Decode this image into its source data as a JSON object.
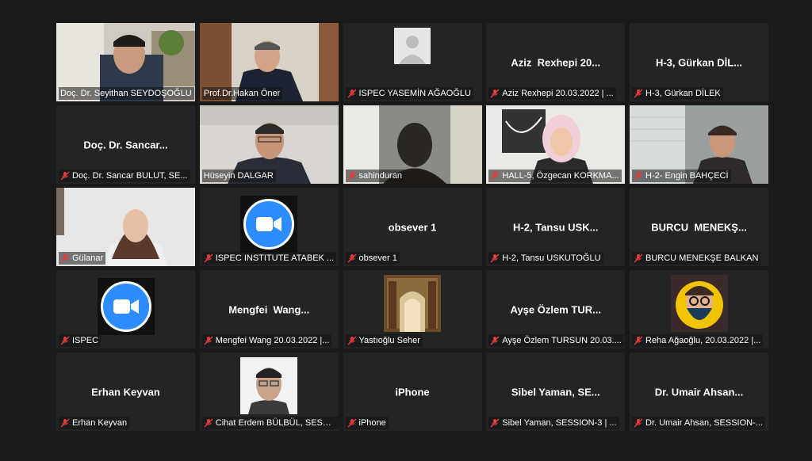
{
  "meeting": {
    "participants": [
      {
        "name": "Doç. Dr. Seyithan SEYDOŞOĞLU",
        "display": ""
      },
      {
        "name": "Prof.Dr.Hakan Öner",
        "display": ""
      },
      {
        "name": "ISPEC YASEMİN AĞAOĞLU",
        "display": ""
      },
      {
        "name": "Aziz  Rexhepi 20.03.2022 | ...",
        "display": "Aziz  Rexhepi 20..."
      },
      {
        "name": "H-3, Gürkan DİLEK",
        "display": "H-3, Gürkan DİL..."
      },
      {
        "name": "Doç. Dr. Sancar BULUT, SE...",
        "display": "Doç. Dr. Sancar..."
      },
      {
        "name": "Hüseyin DALGAR",
        "display": ""
      },
      {
        "name": "sahinduran",
        "display": ""
      },
      {
        "name": "HALL-5, Özgecan KORKMA...",
        "display": ""
      },
      {
        "name": "H-2- Engin BAHÇECİ",
        "display": ""
      },
      {
        "name": "Gülanar",
        "display": ""
      },
      {
        "name": "ISPEC INSTITUTE ATABEK ...",
        "display": ""
      },
      {
        "name": "obsever 1",
        "display": "obsever 1"
      },
      {
        "name": "H-2, Tansu USKUTOĞLU",
        "display": "H-2, Tansu USK..."
      },
      {
        "name": "BURCU MENEKŞE BALKAN",
        "display": "BURCU  MENEKŞ..."
      },
      {
        "name": "ISPEC",
        "display": ""
      },
      {
        "name": "Mengfei Wang 20.03.2022 |...",
        "display": "Mengfei  Wang..."
      },
      {
        "name": "Yastıoğlu Seher",
        "display": ""
      },
      {
        "name": "Ayşe Özlem TURSUN 20.03....",
        "display": "Ayşe Özlem TUR..."
      },
      {
        "name": "Reha Ağaoğlu, 20.03.2022 |...",
        "display": ""
      },
      {
        "name": "Erhan Keyvan",
        "display": "Erhan Keyvan"
      },
      {
        "name": "Cihat Erdem BÜLBÜL, SESSI...",
        "display": ""
      },
      {
        "name": "iPhone",
        "display": "iPhone"
      },
      {
        "name": "Sibel Yaman, SESSION-3 | ...",
        "display": "Sibel Yaman, SE..."
      },
      {
        "name": "Dr. Umair Ahsan, SESSION-...",
        "display": "Dr. Umair Ahsan..."
      }
    ]
  },
  "colors": {
    "active_border": "#d7e04a",
    "muted_icon": "#e03c3c",
    "zoom_blue": "#2d8cff"
  },
  "icons": {
    "muted": "microphone-muted-icon",
    "zoom": "zoom-logo-icon"
  }
}
